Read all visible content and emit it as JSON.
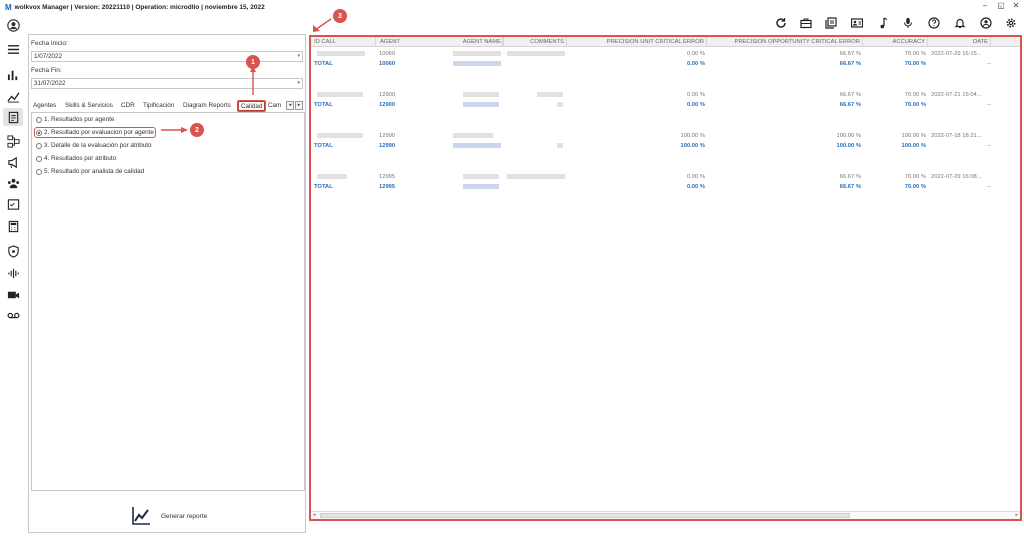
{
  "window": {
    "title": "wolkvox Manager  | Version: 20221110  |  Operation: microdllo  | noviembre 15, 2022",
    "logo": "M",
    "controls": {
      "minimize": "–",
      "restore": "◱",
      "close": "✕"
    }
  },
  "sidebar_icons": [
    "user-icon",
    "menu-icon",
    "bar-chart-icon",
    "line-chart-icon",
    "report-icon",
    "flow-icon",
    "megaphone-icon",
    "group-icon",
    "checklist-icon",
    "calculator-icon",
    "shield-icon",
    "audio-wave-icon",
    "video-call-icon",
    "voicemail-icon"
  ],
  "toolbar_icons": [
    "refresh-icon",
    "briefcase-icon",
    "library-icon",
    "contact-card-icon",
    "music-note-icon",
    "microphone-icon",
    "help-icon",
    "bell-icon",
    "user-circle-icon",
    "settings-icon"
  ],
  "filters": {
    "start_label": "Fecha Inicio:",
    "start_value": "1/07/2022",
    "end_label": "Fecha Fin:",
    "end_value": "31/07/2022"
  },
  "tabs": [
    "Agentes",
    "Skills & Servicios",
    "CDR",
    "Tipificación",
    "Diagram Reports",
    "Calidad",
    "Cam"
  ],
  "selected_tab": "Calidad",
  "tab_nav": {
    "prev": "◂",
    "next": "▸"
  },
  "report_options": [
    {
      "label": "1. Resultados por agente",
      "selected": false
    },
    {
      "label": "2. Resultado por evaluacion por agente",
      "selected": true
    },
    {
      "label": "3. Detalle de la evaluación por atributo",
      "selected": false
    },
    {
      "label": "4. Resultados por atributo",
      "selected": false
    },
    {
      "label": "5. Resultado por analista de calidad",
      "selected": false
    }
  ],
  "generate_button": "Generar reporte",
  "callouts": [
    "1",
    "2",
    "3"
  ],
  "grid": {
    "columns": [
      "ID CALL",
      "AGENT",
      "AGENT NAME",
      "COMMENTS",
      "PRECISION UNIT CRITICAL ERROR",
      "PRECISION OPPORTUNITY CRITICAL ERROR",
      "ACCURACY",
      "DATE"
    ],
    "groups": [
      {
        "agent": "10060",
        "pu": "0.00 %",
        "po": "66.67 %",
        "acc": "70.00 %",
        "date": "2022-07-29 16:15...",
        "total_label": "TOTAL",
        "total_agent": "10060",
        "total_pu": "0.00 %",
        "total_po": "66.67 %",
        "total_acc": "70.00 %",
        "total_date": "--"
      },
      {
        "agent": "12900",
        "pu": "0.00 %",
        "po": "66.67 %",
        "acc": "70.00 %",
        "date": "2022-07-21 15:04...",
        "total_label": "TOTAL",
        "total_agent": "12900",
        "total_pu": "0.00 %",
        "total_po": "66.67 %",
        "total_acc": "70.00 %",
        "total_date": "--"
      },
      {
        "agent": "12990",
        "pu": "100.00 %",
        "po": "100.00 %",
        "acc": "100.00 %",
        "date": "2022-07-18 18:31...",
        "total_label": "TOTAL",
        "total_agent": "12990",
        "total_pu": "100.00 %",
        "total_po": "100.00 %",
        "total_acc": "100.00 %",
        "total_date": "--"
      },
      {
        "agent": "12995",
        "pu": "0.00 %",
        "po": "66.67 %",
        "acc": "70.00 %",
        "date": "2022-07-29 16:08...",
        "total_label": "TOTAL",
        "total_agent": "12995",
        "total_pu": "0.00 %",
        "total_po": "66.67 %",
        "total_acc": "70.00 %",
        "total_date": "--"
      }
    ]
  },
  "scroll_arrows": {
    "left": "◂",
    "right": "▸"
  },
  "colors": {
    "accent_red": "#d9534f",
    "total_blue": "#2a6ebb"
  }
}
